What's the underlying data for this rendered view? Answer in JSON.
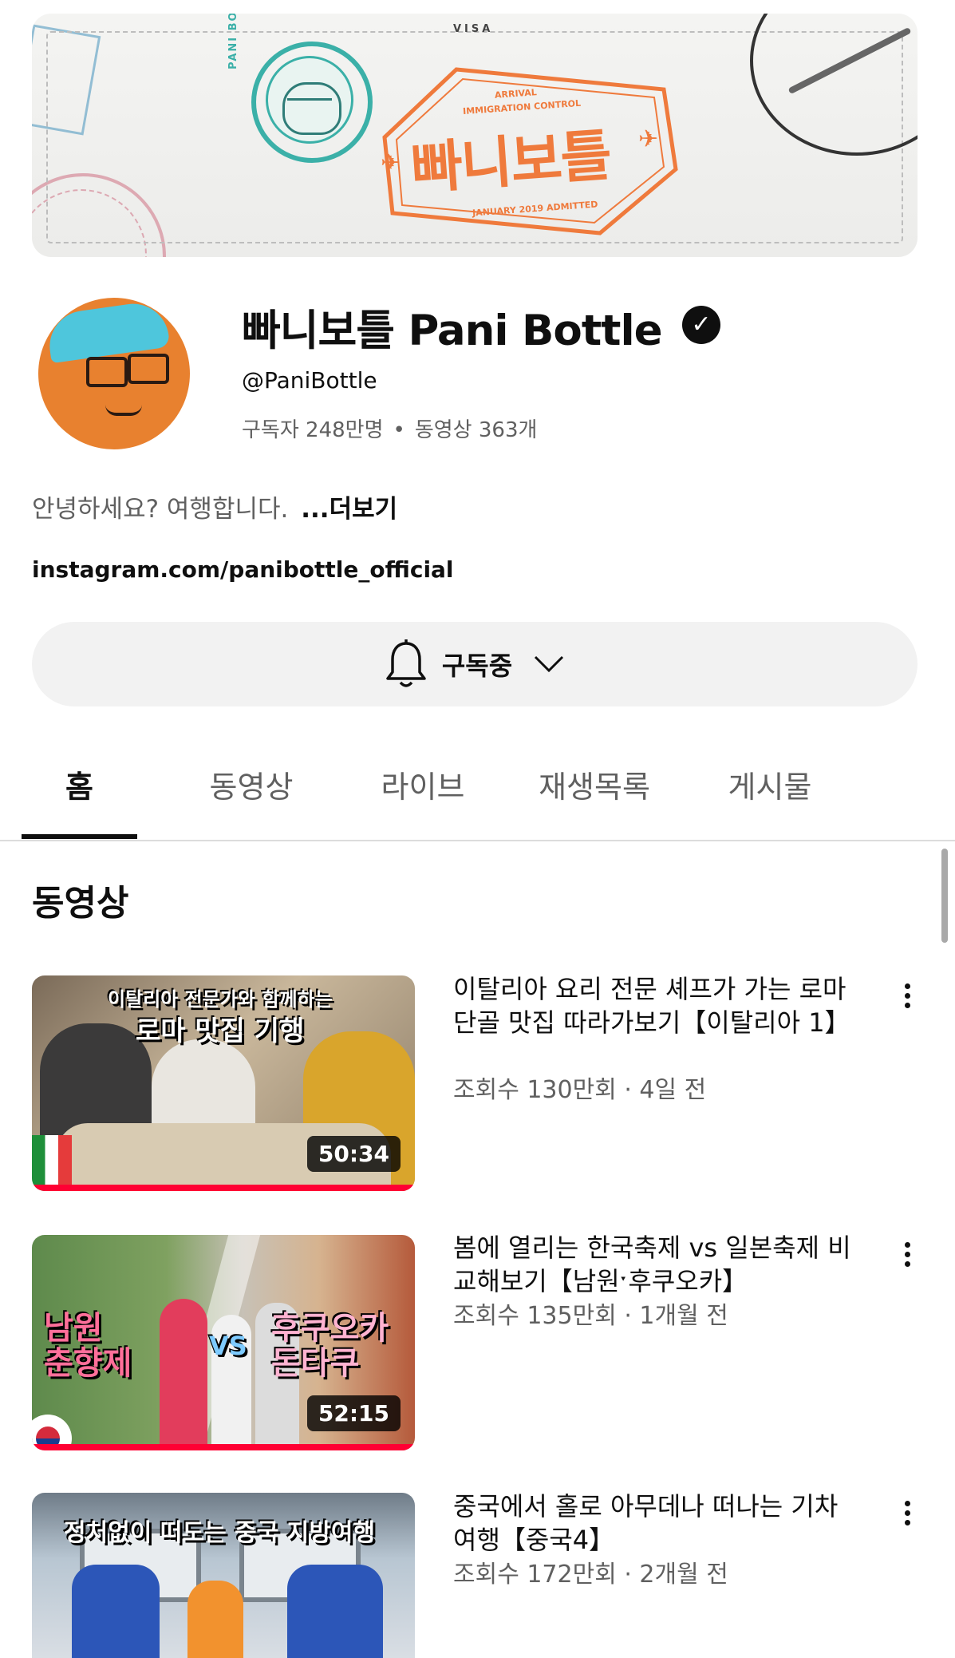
{
  "banner": {
    "visa": "VISA",
    "title": "빠니보틀",
    "arrival": "ARRIVAL",
    "immigration": "IMMIGRATION CONTROL",
    "admitted": "JANUARY 2019 ADMITTED",
    "side_text": "PANI BOTTLE"
  },
  "channel": {
    "name": "빠니보틀 Pani Bottle",
    "handle": "@PaniBottle",
    "subscribers": "구독자 248만명",
    "videos_count": "동영상 363개",
    "description": "안녕하세요? 여행합니다.",
    "more": "...더보기",
    "link": "instagram.com/panibottle_official"
  },
  "subscribe": {
    "label": "구독중"
  },
  "tabs": [
    {
      "label": "홈",
      "active": true
    },
    {
      "label": "동영상"
    },
    {
      "label": "라이브"
    },
    {
      "label": "재생목록"
    },
    {
      "label": "게시물"
    }
  ],
  "section": {
    "title": "동영상"
  },
  "videos": [
    {
      "title": "이탈리아 요리 전문 셰프가 가는 로마 단골 맛집 따라가보기【이탈리아 1】",
      "meta": "조회수 130만회 · 4일 전",
      "duration": "50:34",
      "thumb_caption_1": "이탈리아 전문가와 함께하는",
      "thumb_caption_2": "로마 맛집 기행"
    },
    {
      "title": "봄에 열리는 한국축제 vs 일본축제 비교해보기【남원ˑ후쿠오카】",
      "meta": "조회수 135만회 · 1개월 전",
      "duration": "52:15",
      "thumb_caption_1": "남원\n춘향제",
      "thumb_caption_vs": "VS",
      "thumb_caption_2": "후쿠오카\n돈타쿠"
    },
    {
      "title": "중국에서 홀로 아무데나 떠나는 기차 여행【중국4】",
      "meta": "조회수 172만회 · 2개월 전",
      "thumb_caption_1": "정처없이 떠도는 중국 지방여행"
    }
  ],
  "colors": {
    "accent_red": "#ff0033",
    "banner_orange": "#ef7a3c",
    "banner_teal": "#3bb0a8",
    "secondary_text": "#606060"
  }
}
